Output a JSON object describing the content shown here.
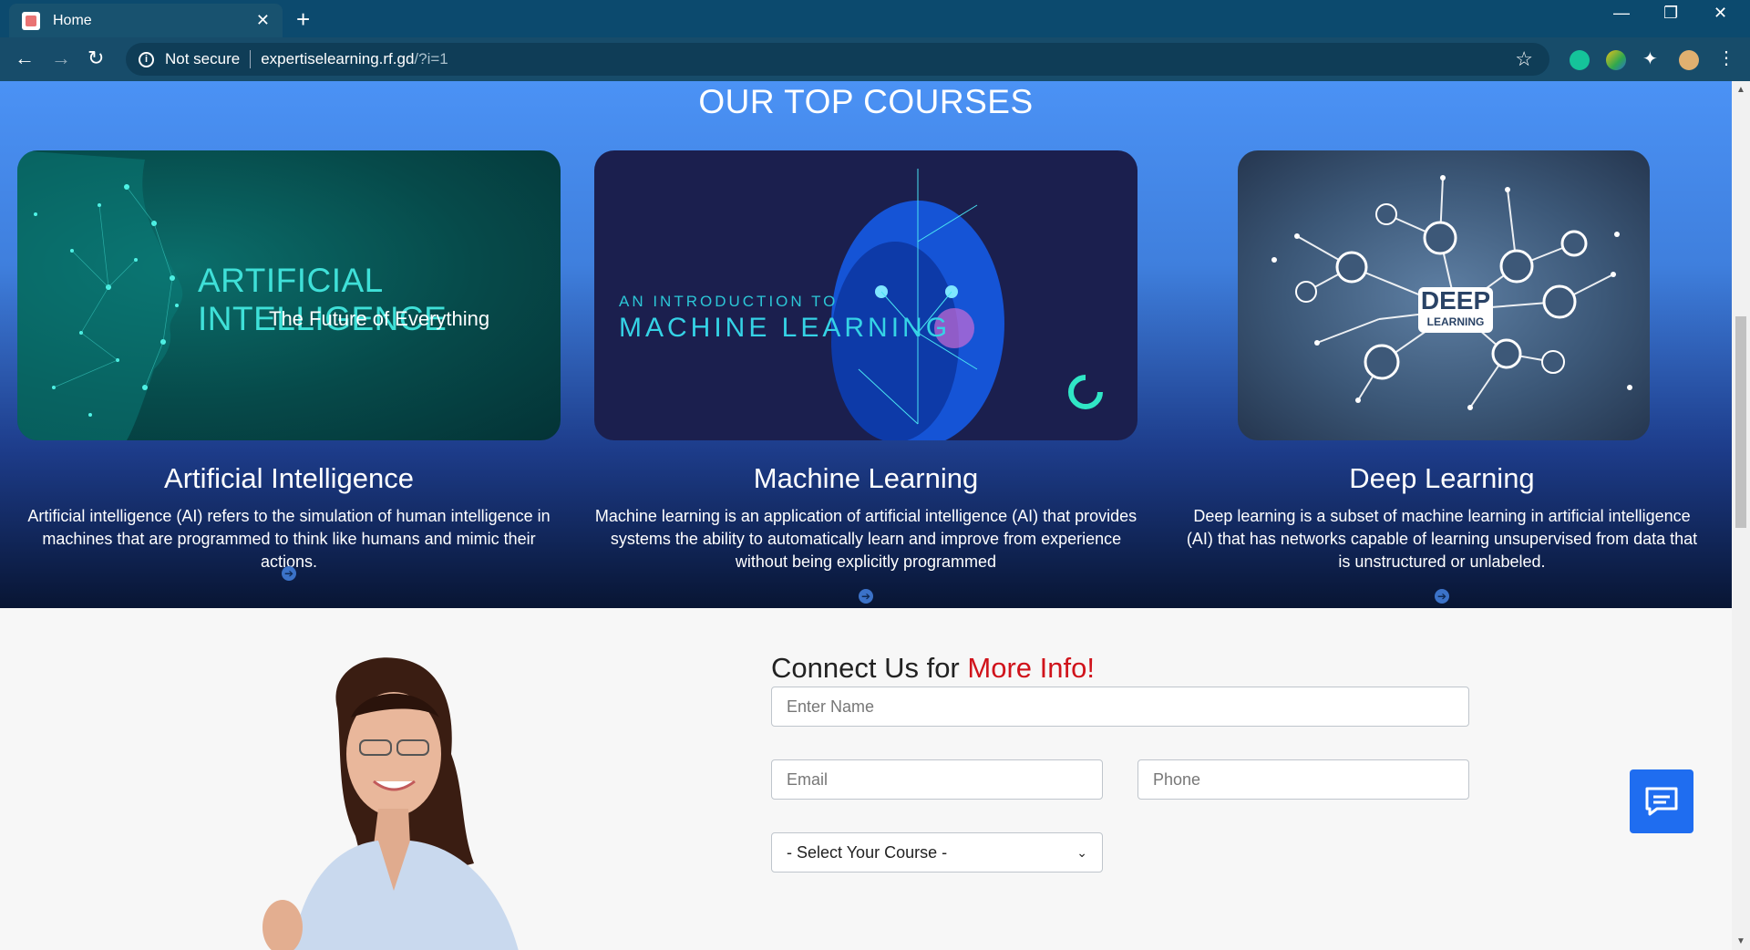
{
  "browser": {
    "tab_title": "Home",
    "new_tab": "+",
    "close_tab": "✕",
    "minimize": "—",
    "restore": "❐",
    "close_window": "✕",
    "security_label": "Not secure",
    "url_host": "expertiselearning.rf.gd",
    "url_path": "/?i=1",
    "bookmark_icon": "star-icon"
  },
  "courses": {
    "heading": "OUR TOP COURSES",
    "items": [
      {
        "title": "Artificial Intelligence",
        "description": "Artificial intelligence (AI) refers to the simulation of human intelligence in machines that are programmed to think like humans and mimic their actions.",
        "image_title": "ARTIFICIAL INTELLIGENCE",
        "image_subtitle": "The Future of Everything"
      },
      {
        "title": "Machine Learning",
        "description": "Machine learning is an application of artificial intelligence (AI) that provides systems the ability to automatically learn and improve from experience without being explicitly programmed",
        "image_supertitle": "AN INTRODUCTION TO",
        "image_title": "MACHINE LEARNING"
      },
      {
        "title": "Deep Learning",
        "description": "Deep learning is a subset of machine learning in artificial intelligence (AI) that has networks capable of learning unsupervised from data that is unstructured or unlabeled.",
        "image_title": "DEEP",
        "image_subtitle": "LEARNING"
      }
    ]
  },
  "contact": {
    "heading_plain": "Connect Us for ",
    "heading_accent": "More Info!",
    "name_placeholder": "Enter Name",
    "email_placeholder": "Email",
    "phone_placeholder": "Phone",
    "course_select": "- Select Your Course -"
  },
  "colors": {
    "accent_red": "#d0131b",
    "chat_blue": "#1f6df0",
    "tabbar": "#0c4a6e"
  }
}
